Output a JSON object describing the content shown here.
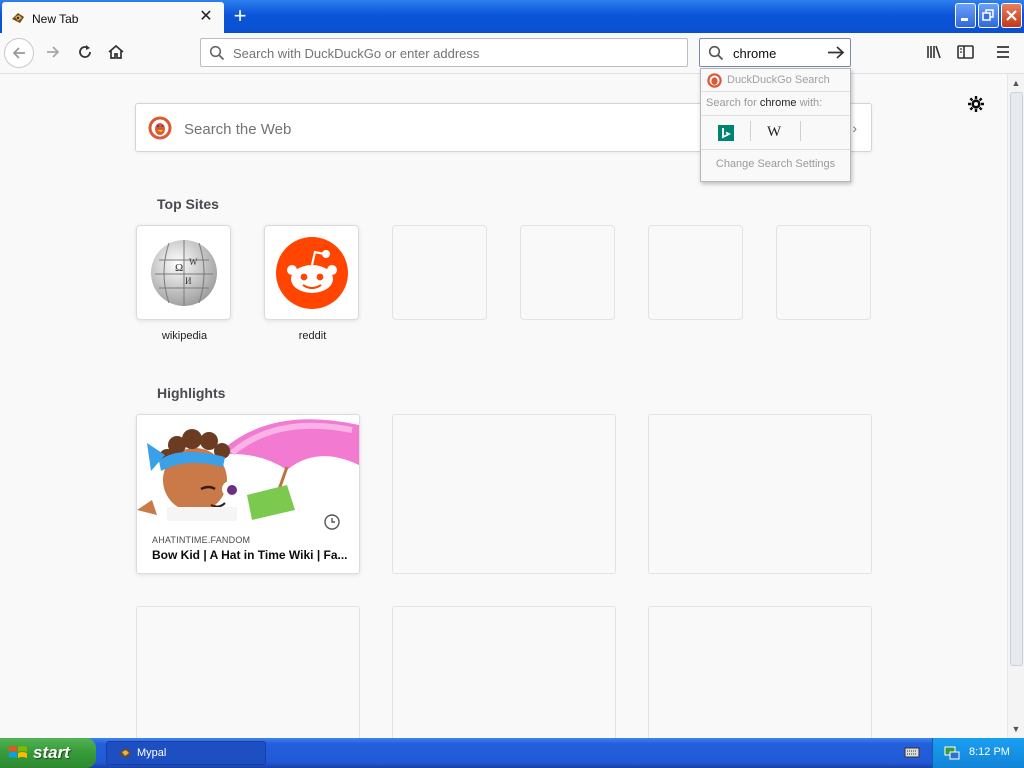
{
  "browser": {
    "tab_title": "New Tab",
    "url_placeholder": "Search with DuckDuckGo or enter address",
    "search_value": "chrome"
  },
  "search_dropdown": {
    "engine_name": "DuckDuckGo Search",
    "search_for_prefix": "Search for",
    "search_for_term": "chrome",
    "search_for_suffix": "with:",
    "alt_engines": [
      "Bing",
      "Wikipedia"
    ],
    "settings_label": "Change Search Settings"
  },
  "newtab": {
    "search_placeholder": "Search the Web",
    "top_sites_title": "Top Sites",
    "top_sites": [
      {
        "label": "wikipedia",
        "icon": "wikipedia-globe-icon"
      },
      {
        "label": "reddit",
        "icon": "reddit-alien-icon"
      }
    ],
    "highlights_title": "Highlights",
    "highlights": [
      {
        "source": "AHATINTIME.FANDOM",
        "title": "Bow Kid | A Hat in Time Wiki | Fa..."
      }
    ]
  },
  "taskbar": {
    "start_label": "start",
    "task_label": "Mypal",
    "clock": "8:12 PM"
  },
  "colors": {
    "titlebar": "#0a55d9",
    "page_bg": "#f9f9fa",
    "reddit": "#ff4500",
    "start_green": "#369a39"
  }
}
